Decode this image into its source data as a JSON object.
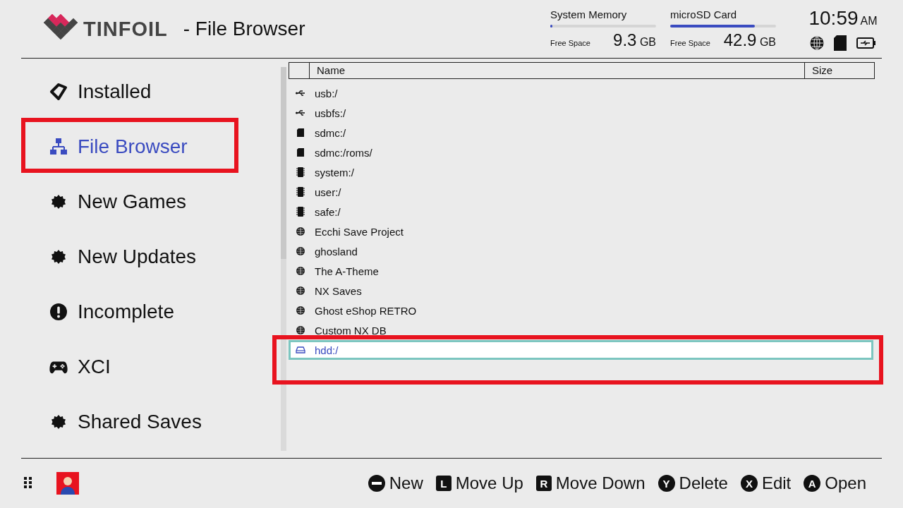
{
  "header": {
    "brand": "TINFOIL",
    "title": "- File Browser",
    "storage": [
      {
        "label": "System Memory",
        "level": 0.01,
        "caption": "Free Space",
        "amount": "9.3",
        "unit": "GB"
      },
      {
        "label": "microSD Card",
        "level": 0.8,
        "caption": "Free Space",
        "amount": "42.9",
        "unit": "GB"
      }
    ],
    "time": "10:59",
    "ampm": "AM"
  },
  "sidebar": {
    "items": [
      {
        "label": "Installed",
        "kind": "tag",
        "selected": false,
        "highlighted": false
      },
      {
        "label": "File Browser",
        "kind": "network",
        "selected": true,
        "highlighted": true
      },
      {
        "label": "New Games",
        "kind": "new",
        "selected": false,
        "highlighted": false
      },
      {
        "label": "New Updates",
        "kind": "new",
        "selected": false,
        "highlighted": false
      },
      {
        "label": "Incomplete",
        "kind": "alert",
        "selected": false,
        "highlighted": false
      },
      {
        "label": "XCI",
        "kind": "gamepad",
        "selected": false,
        "highlighted": false
      },
      {
        "label": "Shared Saves",
        "kind": "new",
        "selected": false,
        "highlighted": false
      }
    ]
  },
  "table": {
    "columns": [
      "Name",
      "Size"
    ],
    "rows": [
      {
        "name": "usb:/",
        "kind": "usb",
        "selected": false,
        "highlighted": false
      },
      {
        "name": "usbfs:/",
        "kind": "usb",
        "selected": false,
        "highlighted": false
      },
      {
        "name": "sdmc:/",
        "kind": "sd",
        "selected": false,
        "highlighted": false
      },
      {
        "name": "sdmc:/roms/",
        "kind": "sd",
        "selected": false,
        "highlighted": false
      },
      {
        "name": "system:/",
        "kind": "chip",
        "selected": false,
        "highlighted": false
      },
      {
        "name": "user:/",
        "kind": "chip",
        "selected": false,
        "highlighted": false
      },
      {
        "name": "safe:/",
        "kind": "chip",
        "selected": false,
        "highlighted": false
      },
      {
        "name": "Ecchi Save Project",
        "kind": "globe",
        "selected": false,
        "highlighted": false
      },
      {
        "name": "ghosland",
        "kind": "globe",
        "selected": false,
        "highlighted": false
      },
      {
        "name": "The A-Theme",
        "kind": "globe",
        "selected": false,
        "highlighted": false
      },
      {
        "name": "NX Saves",
        "kind": "globe",
        "selected": false,
        "highlighted": false
      },
      {
        "name": "Ghost eShop RETRO",
        "kind": "globe",
        "selected": false,
        "highlighted": false
      },
      {
        "name": "Custom NX DB",
        "kind": "globe",
        "selected": false,
        "highlighted": false
      },
      {
        "name": "hdd:/",
        "kind": "hdd",
        "selected": true,
        "highlighted": true
      }
    ]
  },
  "footer": {
    "actions": [
      {
        "kind": "minus",
        "label": "New"
      },
      {
        "kind": "square",
        "key": "L",
        "label": "Move Up"
      },
      {
        "kind": "square",
        "key": "R",
        "label": "Move Down"
      },
      {
        "kind": "circle",
        "key": "Y",
        "label": "Delete"
      },
      {
        "kind": "circle",
        "key": "X",
        "label": "Edit"
      },
      {
        "kind": "circle",
        "key": "A",
        "label": "Open"
      }
    ]
  }
}
